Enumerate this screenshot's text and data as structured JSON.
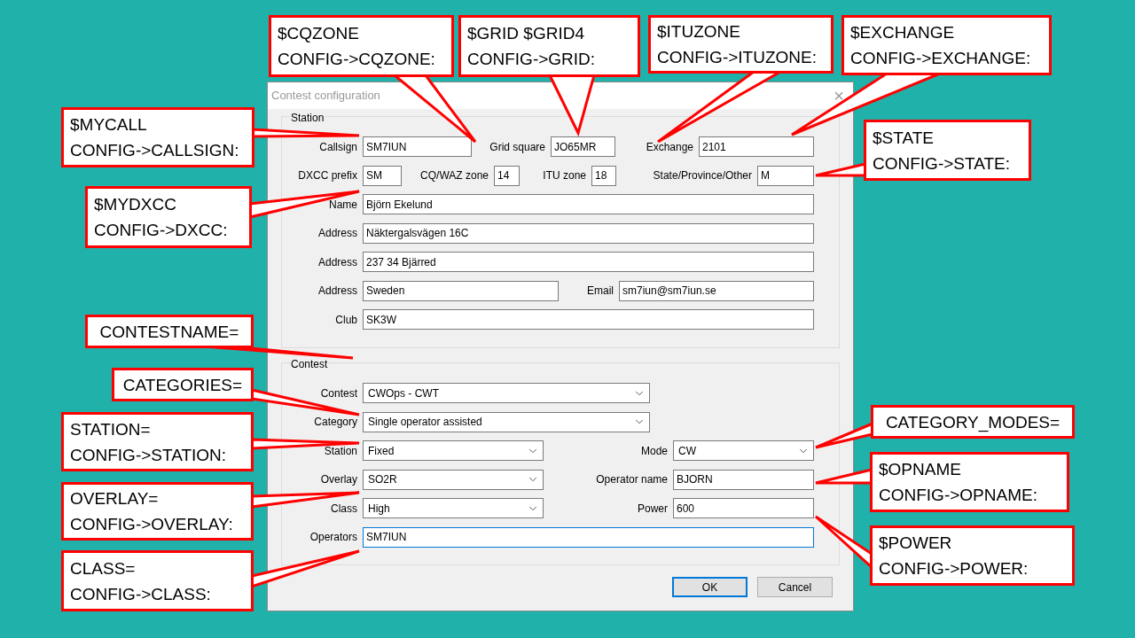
{
  "dialog": {
    "title": "Contest configuration",
    "close": "×",
    "station_group": {
      "title": "Station",
      "row1": [
        {
          "label": "Callsign",
          "value": "SM7IUN"
        },
        {
          "label": "Grid square",
          "value": "JO65MR"
        },
        {
          "label": "Exchange",
          "value": "2101"
        }
      ],
      "row2": [
        {
          "label": "DXCC prefix",
          "value": "SM"
        },
        {
          "label": "CQ/WAZ zone",
          "value": "14"
        },
        {
          "label": "ITU zone",
          "value": "18"
        },
        {
          "label": "State/Province/Other",
          "value": "M"
        }
      ],
      "name": {
        "label": "Name",
        "value": "Björn Ekelund"
      },
      "address1": {
        "label": "Address",
        "value": "Näktergalsvägen 16C"
      },
      "address2": {
        "label": "Address",
        "value": "237 34 Bjärred"
      },
      "address3": {
        "label": "Address",
        "value": "Sweden"
      },
      "email": {
        "label": "Email",
        "value": "sm7iun@sm7iun.se"
      },
      "club": {
        "label": "Club",
        "value": "SK3W"
      }
    },
    "contest_group": {
      "title": "Contest",
      "contest": {
        "label": "Contest",
        "value": "CWOps - CWT"
      },
      "category": {
        "label": "Category",
        "value": "Single operator assisted"
      },
      "pairs": [
        {
          "left": {
            "label": "Station",
            "value": "Fixed",
            "kind": "combo"
          },
          "right": {
            "label": "Mode",
            "value": "CW",
            "kind": "combo"
          }
        },
        {
          "left": {
            "label": "Overlay",
            "value": "SO2R",
            "kind": "combo"
          },
          "right": {
            "label": "Operator name",
            "value": "BJORN",
            "kind": "text"
          }
        },
        {
          "left": {
            "label": "Class",
            "value": "High",
            "kind": "combo"
          },
          "right": {
            "label": "Power",
            "value": "600",
            "kind": "text"
          }
        }
      ],
      "operators": {
        "label": "Operators",
        "value": "SM7IUN",
        "focused": true
      }
    },
    "buttons": [
      {
        "label": "OK",
        "default": true
      },
      {
        "label": "Cancel",
        "default": false
      }
    ]
  },
  "callouts": [
    {
      "lines": [
        "$CQZONE",
        "CONFIG->CQZONE:"
      ]
    },
    {
      "lines": [
        "$GRID $GRID4",
        "CONFIG->GRID:"
      ]
    },
    {
      "lines": [
        "$ITUZONE",
        "CONFIG->ITUZONE:"
      ]
    },
    {
      "lines": [
        "$EXCHANGE",
        "CONFIG->EXCHANGE:"
      ]
    },
    {
      "lines": [
        "$MYCALL",
        "CONFIG->CALLSIGN:"
      ]
    },
    {
      "lines": [
        "$STATE",
        "CONFIG->STATE:"
      ]
    },
    {
      "lines": [
        "$MYDXCC",
        "CONFIG->DXCC:"
      ]
    },
    {
      "lines": [
        "CONTESTNAME="
      ]
    },
    {
      "lines": [
        "CATEGORIES="
      ]
    },
    {
      "lines": [
        "STATION=",
        "CONFIG->STATION:"
      ]
    },
    {
      "lines": [
        "OVERLAY=",
        "CONFIG->OVERLAY:"
      ]
    },
    {
      "lines": [
        "CLASS=",
        "CONFIG->CLASS:"
      ]
    },
    {
      "lines": [
        "CATEGORY_MODES="
      ]
    },
    {
      "lines": [
        "$OPNAME",
        "CONFIG->OPNAME:"
      ]
    },
    {
      "lines": [
        "$POWER",
        "CONFIG->POWER:"
      ]
    }
  ]
}
